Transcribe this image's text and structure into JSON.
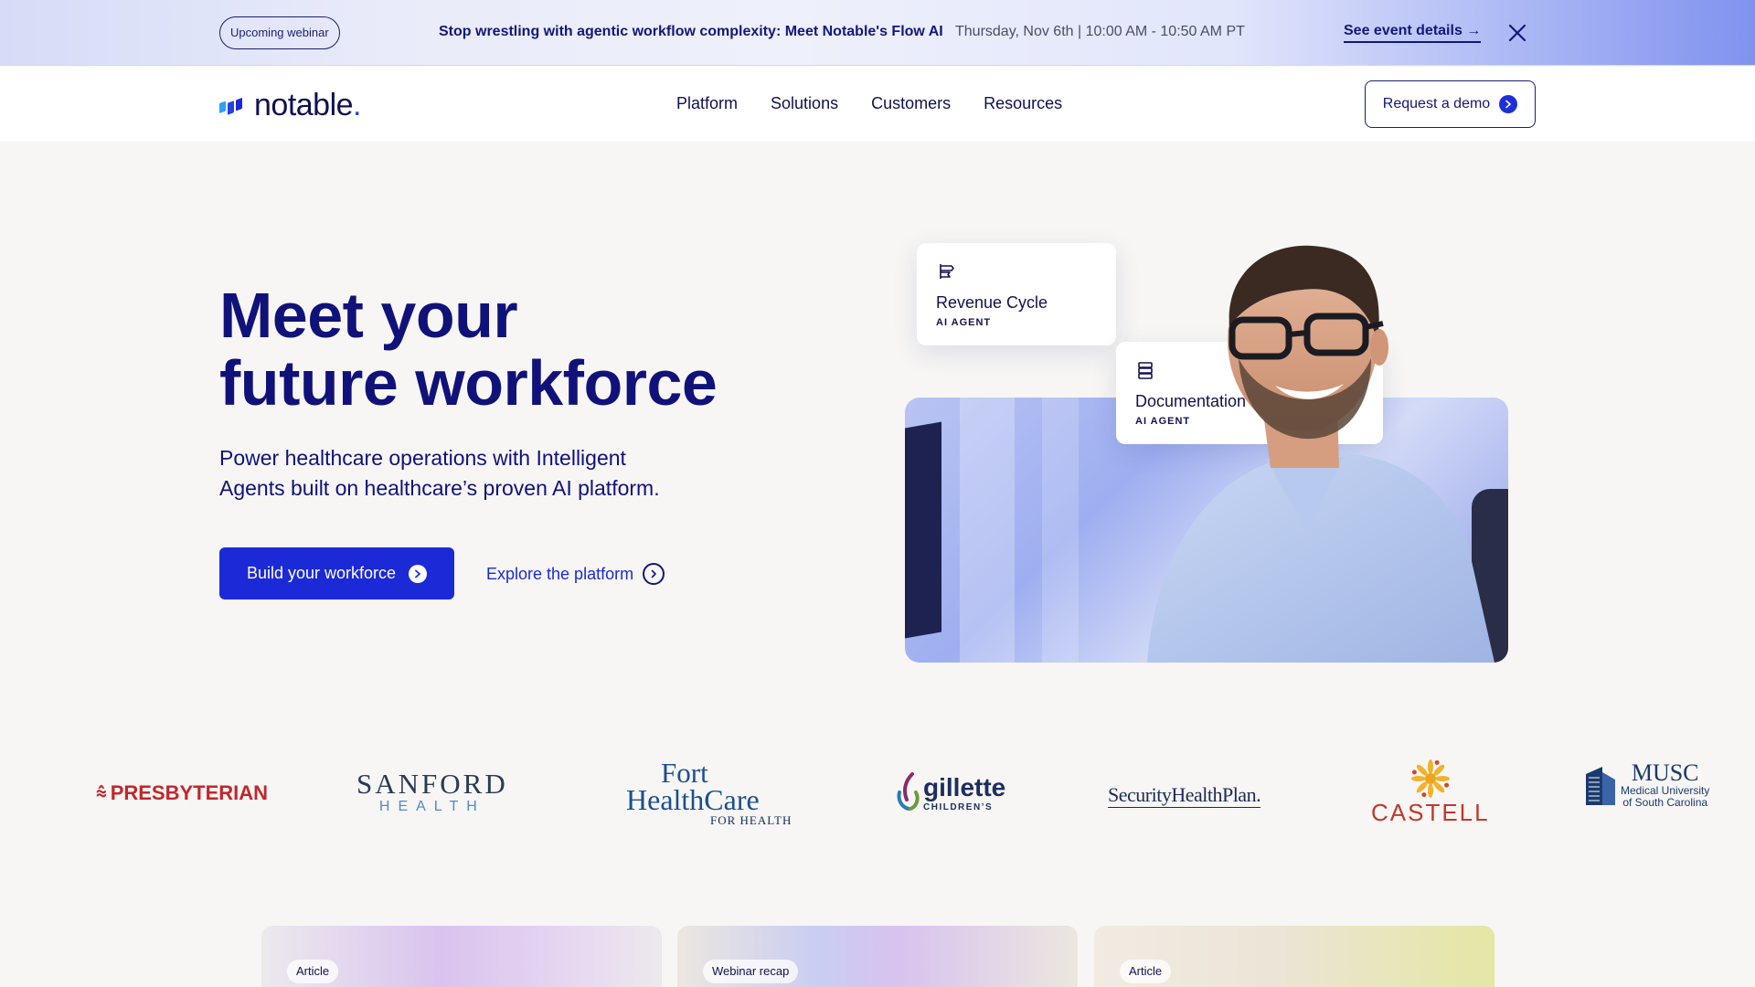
{
  "banner": {
    "pill": "Upcoming webinar",
    "headline": "Stop wrestling with agentic workflow complexity: Meet Notable's Flow AI",
    "when": "Thursday, Nov 6th | 10:00 AM - 10:50 AM PT",
    "details_link": "See event details →",
    "close_icon": "close-icon"
  },
  "nav": {
    "logo": "notable",
    "links": [
      "Platform",
      "Solutions",
      "Customers",
      "Resources"
    ],
    "demo_button": "Request a demo"
  },
  "hero": {
    "title_line1": "Meet your",
    "title_line2": "future workforce",
    "subtitle_line1": "Power healthcare operations with Intelligent",
    "subtitle_line2": "Agents built on healthcare’s proven AI platform.",
    "primary_button": "Build your workforce",
    "secondary_button": "Explore the platform",
    "cards": [
      {
        "title": "Revenue Cycle",
        "tag": "AI AGENT"
      },
      {
        "title": "Documentation",
        "tag": "AI AGENT"
      }
    ]
  },
  "customers": {
    "presbyterian": "PRESBYTERIAN",
    "sanford_1": "SANFORD",
    "sanford_2": "HEALTH",
    "fort_1": "Fort",
    "fort_2": "HealthCare",
    "fort_3": "FOR HEALTH",
    "gillette_1": "gillette",
    "gillette_2": "CHILDREN’S",
    "shp": "SecurityHealthPlan.",
    "castell": "CASTELL",
    "musc_1": "MUSC",
    "musc_2": "Medical University",
    "musc_3": "of South Carolina"
  },
  "resources": [
    {
      "badge": "Article"
    },
    {
      "badge": "Webinar recap"
    },
    {
      "badge": "Article"
    }
  ],
  "colors": {
    "brand": "#1b2ad6",
    "ink": "#10127a",
    "background": "#f7f6f4"
  }
}
